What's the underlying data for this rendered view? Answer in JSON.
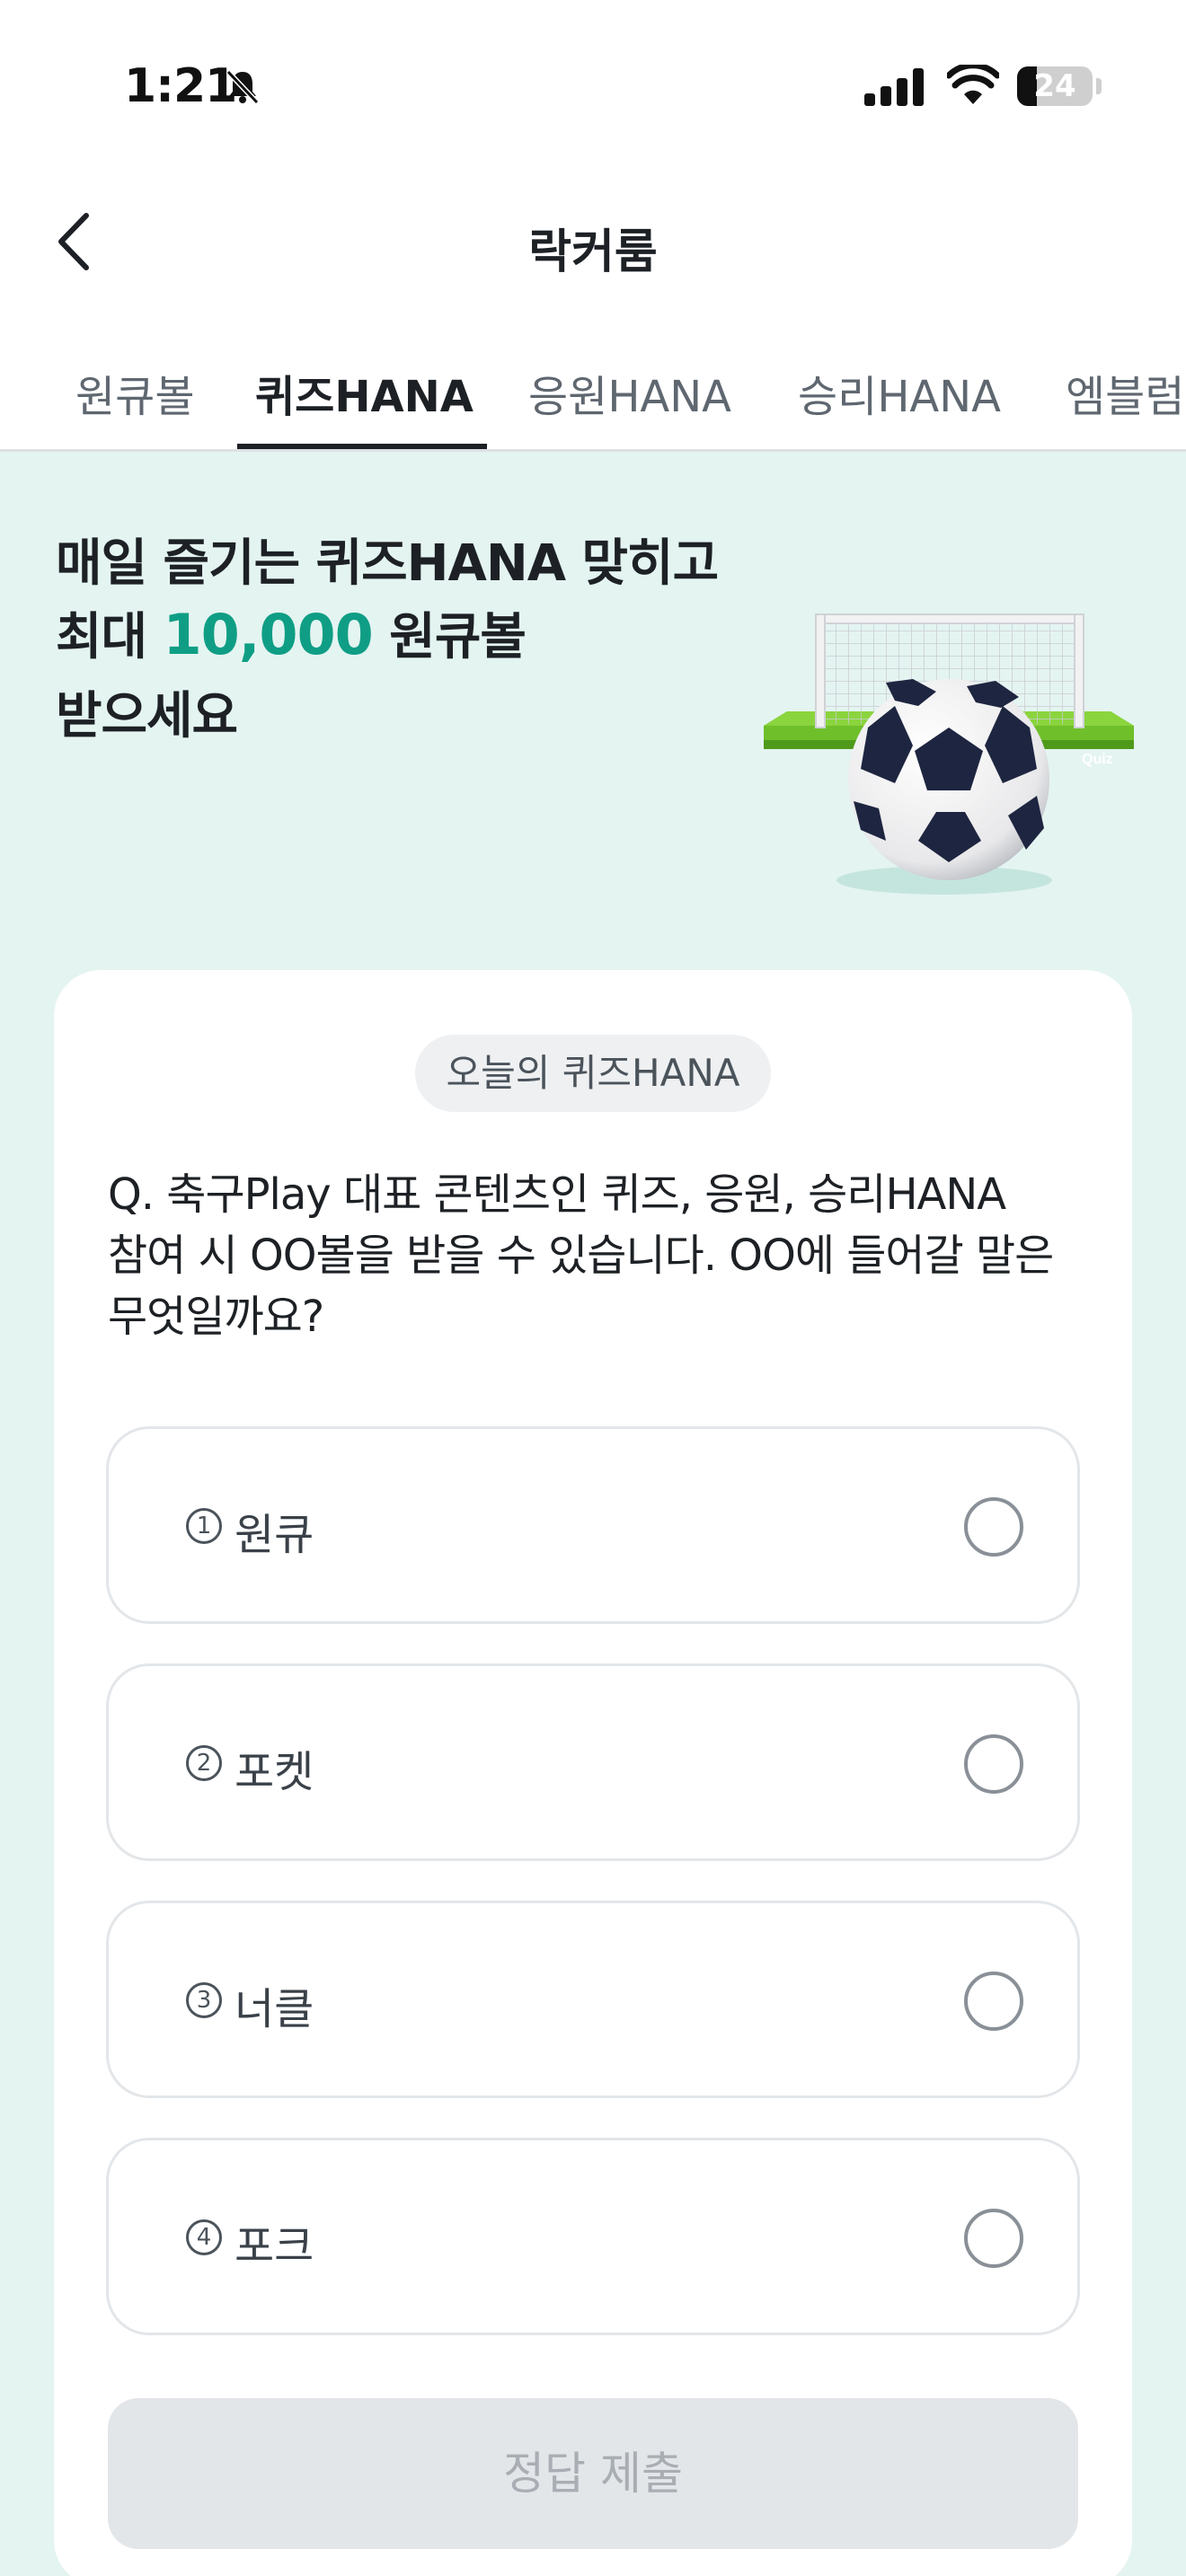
{
  "status_bar": {
    "time": "1:21",
    "battery": "24"
  },
  "header": {
    "title": "락커룸"
  },
  "tabs": [
    {
      "label": "원큐볼",
      "active": false
    },
    {
      "label": "퀴즈HANA",
      "active": true
    },
    {
      "label": "응원HANA",
      "active": false
    },
    {
      "label": "승리HANA",
      "active": false
    },
    {
      "label": "엠블럼",
      "active": false
    }
  ],
  "hero": {
    "line1": "매일 즐기는 퀴즈HANA 맞히고",
    "line2_prefix": "최대 ",
    "line2_amount": "10,000",
    "line2_suffix": " 원큐볼",
    "line3": "받으세요",
    "illustration_label": "Quiz",
    "accent_color": "#0f9e85"
  },
  "quiz": {
    "badge": "오늘의 퀴즈HANA",
    "question_lines": [
      "Q. 축구Play 대표 콘텐츠인 퀴즈, 응원, 승리HANA",
      "참여 시 OO볼을 받을 수 있습니다. OO에 들어갈 말은",
      "무엇일까요?"
    ],
    "options": [
      {
        "num": "1",
        "label": "원큐",
        "selected": false
      },
      {
        "num": "2",
        "label": "포켓",
        "selected": false
      },
      {
        "num": "3",
        "label": "너클",
        "selected": false
      },
      {
        "num": "4",
        "label": "포크",
        "selected": false
      }
    ],
    "submit_label": "정답 제출"
  }
}
